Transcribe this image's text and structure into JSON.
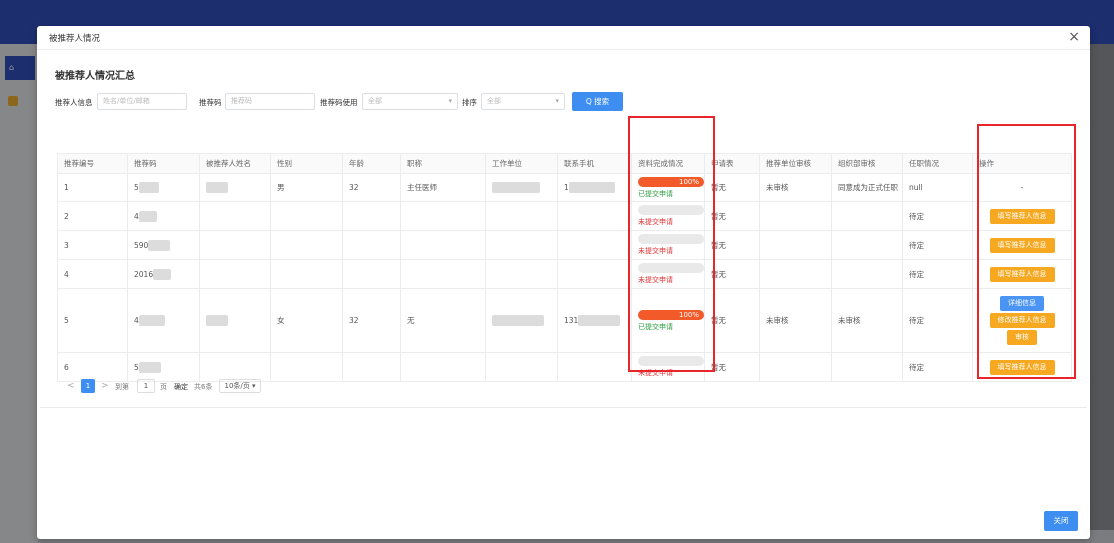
{
  "modal": {
    "title": "被推荐人情况",
    "close_label": "×",
    "section_title": "被推荐人情况汇总",
    "footer_close": "关闭"
  },
  "filters": {
    "recommender_label": "推荐人信息",
    "recommender_placeholder": "姓名/单位/邮箱",
    "code_label": "推荐码",
    "code_placeholder": "推荐码",
    "code_use_label": "推荐码使用",
    "code_use_value": "全部",
    "sort_label": "排序",
    "sort_value": "全部",
    "search_label": "Q 搜索"
  },
  "table": {
    "headers": [
      "推荐编号",
      "推荐码",
      "被推荐人姓名",
      "性别",
      "年龄",
      "职称",
      "工作单位",
      "联系手机",
      "资料完成情况",
      "申请表",
      "推荐单位审核",
      "组织部审核",
      "任职情况",
      "操作"
    ],
    "rows": [
      {
        "no": "1",
        "code": "5",
        "name": "",
        "gender": "男",
        "age": "32",
        "title": "主任医师",
        "unit": "",
        "phone": "1",
        "progress": 100,
        "progress_label": "100%",
        "status": "已提交申请",
        "status_type": "ok",
        "form": "暂无",
        "unit_review": "未审核",
        "org_review": "同意成为正式任职",
        "appoint": "null",
        "actions": [
          {
            "label": "-",
            "type": "text"
          }
        ]
      },
      {
        "no": "2",
        "code": "4",
        "name": "",
        "gender": "",
        "age": "",
        "title": "",
        "unit": "",
        "phone": "",
        "progress": 0,
        "progress_label": "",
        "status": "未提交申请",
        "status_type": "no",
        "form": "暂无",
        "unit_review": "",
        "org_review": "",
        "appoint": "待定",
        "actions": [
          {
            "label": "填写推荐人信息",
            "type": "yellow"
          }
        ]
      },
      {
        "no": "3",
        "code": "590",
        "name": "",
        "gender": "",
        "age": "",
        "title": "",
        "unit": "",
        "phone": "",
        "progress": 0,
        "progress_label": "",
        "status": "未提交申请",
        "status_type": "no",
        "form": "暂无",
        "unit_review": "",
        "org_review": "",
        "appoint": "待定",
        "actions": [
          {
            "label": "填写推荐人信息",
            "type": "yellow"
          }
        ]
      },
      {
        "no": "4",
        "code": "2016",
        "name": "",
        "gender": "",
        "age": "",
        "title": "",
        "unit": "",
        "phone": "",
        "progress": 0,
        "progress_label": "",
        "status": "未提交申请",
        "status_type": "no",
        "form": "暂无",
        "unit_review": "",
        "org_review": "",
        "appoint": "待定",
        "actions": [
          {
            "label": "填写推荐人信息",
            "type": "yellow"
          }
        ]
      },
      {
        "no": "5",
        "code": "4",
        "name": "",
        "gender": "女",
        "age": "32",
        "title": "无",
        "unit": "",
        "phone": "131",
        "progress": 100,
        "progress_label": "100%",
        "status": "已提交申请",
        "status_type": "ok",
        "form": "暂无",
        "unit_review": "未审核",
        "org_review": "未审核",
        "appoint": "待定",
        "actions": [
          {
            "label": "详细信息",
            "type": "blue"
          },
          {
            "label": "修改推荐人信息",
            "type": "yellow"
          },
          {
            "label": "审核",
            "type": "yellow"
          }
        ]
      },
      {
        "no": "6",
        "code": "5",
        "name": "",
        "gender": "",
        "age": "",
        "title": "",
        "unit": "",
        "phone": "",
        "progress": 0,
        "progress_label": "",
        "status": "未提交申请",
        "status_type": "no",
        "form": "暂无",
        "unit_review": "",
        "org_review": "",
        "appoint": "待定",
        "actions": [
          {
            "label": "填写推荐人信息",
            "type": "yellow"
          }
        ]
      }
    ]
  },
  "pager": {
    "prev": "<",
    "current": "1",
    "next": ">",
    "goto_label": "到第",
    "goto_value": "1",
    "page_unit": "页",
    "confirm": "确定",
    "total": "共6条",
    "page_size": "10条/页"
  },
  "colors": {
    "primary": "#3d8ef0",
    "warning": "#f6a821",
    "progress": "#f25a2a",
    "highlight_box": "#e8262a",
    "ok_text": "#2a9d3c",
    "no_text": "#e03030"
  }
}
